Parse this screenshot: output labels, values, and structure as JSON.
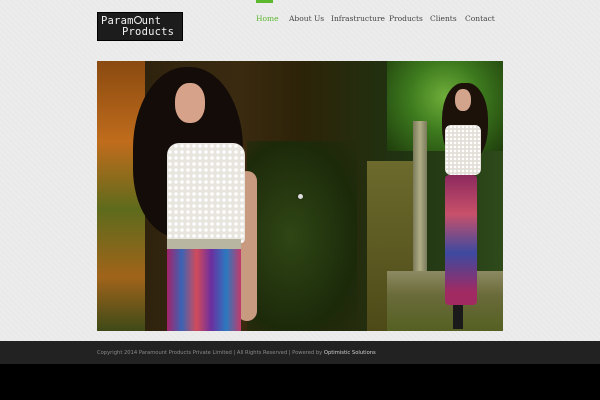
{
  "header": {
    "logo_line1": "Paramount",
    "logo_line2": "Products"
  },
  "nav": {
    "items": [
      {
        "label": "Home",
        "active": true
      },
      {
        "label": "About Us",
        "active": false
      },
      {
        "label": "Infrastructure",
        "active": false
      },
      {
        "label": "Products",
        "active": false
      },
      {
        "label": "Clients",
        "active": false
      },
      {
        "label": "Contact",
        "active": false
      }
    ]
  },
  "footer": {
    "copyright": "Copyright 2014 Paramount Products Private Limited | All Rights Reserved | Powered by ",
    "powered_by": "Optimistic Solutions"
  },
  "colors": {
    "accent": "#5bb82f",
    "footer_bg": "#222222",
    "page_bg": "#eeeeee"
  }
}
